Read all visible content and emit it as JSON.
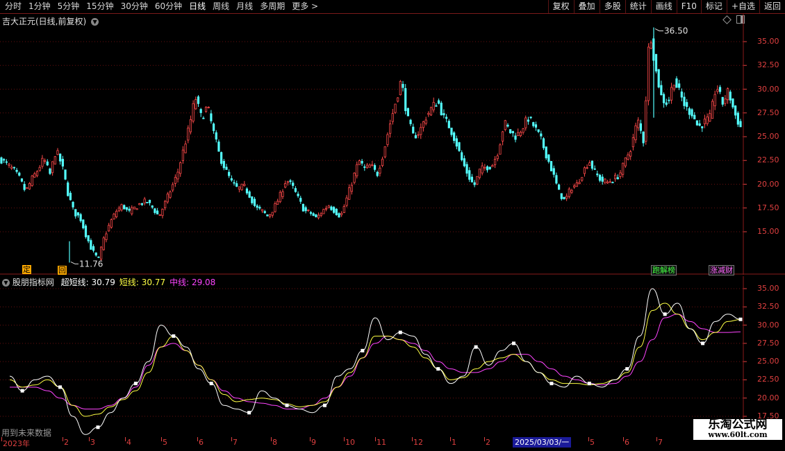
{
  "toolbar": {
    "periods": [
      "分时",
      "1分钟",
      "5分钟",
      "15分钟",
      "30分钟",
      "60分钟",
      "日线",
      "周线",
      "月线",
      "多周期",
      "更多 >"
    ],
    "active_period": "日线",
    "buttons": [
      "复权",
      "叠加",
      "多股",
      "统计",
      "画线",
      "F10",
      "标记",
      "+自选",
      "返回"
    ]
  },
  "main_panel": {
    "title": "吉大正元(日线,前复权)",
    "y_ticks": [
      "35.00",
      "32.50",
      "30.00",
      "27.50",
      "25.00",
      "22.50",
      "20.00",
      "17.50",
      "15.00"
    ],
    "high_label": "36.50",
    "low_label": "11.76",
    "tag_ding": "定",
    "tag_hui": "回",
    "tag_bejiebang": "跑解榜",
    "tag_zhangjiancai": "涨减财"
  },
  "indicator_panel": {
    "title": "股朋指标网",
    "lines": [
      {
        "label": "超短线:",
        "value": "30.79",
        "color": "#ffffff"
      },
      {
        "label": "短线:",
        "value": "30.77",
        "color": "#ffff44"
      },
      {
        "label": "中线:",
        "value": "29.08",
        "color": "#ff44ff"
      }
    ],
    "y_ticks": [
      "35.00",
      "32.50",
      "30.00",
      "27.50",
      "25.00",
      "22.50",
      "20.00",
      "17.50"
    ],
    "footer_note": "用到未来数据"
  },
  "date_axis": {
    "ticks": [
      "2023年",
      "2",
      "3",
      "4",
      "5",
      "6",
      "7",
      "8",
      "9",
      "10",
      "11",
      "12",
      "1",
      "2",
      "5",
      "6",
      "7"
    ],
    "highlight": "2025/03/03/一"
  },
  "watermark": {
    "line1": "乐淘公式网",
    "line2": "www.60lt.com"
  },
  "colors": {
    "up": "#ff4a4a",
    "down": "#54ffff",
    "axis": "#e04040",
    "grid": "#6a1010"
  },
  "chart_data": {
    "type": "line",
    "title": "吉大正元(日线,前复权)",
    "ylim": [
      12,
      37
    ],
    "high": 36.5,
    "low": 11.76,
    "price_path": [
      22.6,
      22.0,
      21.5,
      20.6,
      19.2,
      20.5,
      21.5,
      22.7,
      21.0,
      23.6,
      22.0,
      19.0,
      17.0,
      16.5,
      14.6,
      13.0,
      12.0,
      14.5,
      16.0,
      17.2,
      17.8,
      17.0,
      17.5,
      18.0,
      18.2,
      17.5,
      16.6,
      18.0,
      19.5,
      21.0,
      23.5,
      26.0,
      29.2,
      27.0,
      28.2,
      25.5,
      23.0,
      21.5,
      20.2,
      19.5,
      19.8,
      18.8,
      17.5,
      17.2,
      16.6,
      17.5,
      18.8,
      20.5,
      19.8,
      18.5,
      17.2,
      17.0,
      16.4,
      17.2,
      17.8,
      17.2,
      16.6,
      18.5,
      20.5,
      22.5,
      21.6,
      22.0,
      21.0,
      23.2,
      26.0,
      28.5,
      31.0,
      27.0,
      25.0,
      25.5,
      27.0,
      28.0,
      28.8,
      27.0,
      26.0,
      24.5,
      22.5,
      21.0,
      19.8,
      21.5,
      21.8,
      22.0,
      23.5,
      26.5,
      25.5,
      25.0,
      26.0,
      27.0,
      26.0,
      24.8,
      23.0,
      21.2,
      19.2,
      18.2,
      19.6,
      20.0,
      21.3,
      22.5,
      21.2,
      20.4,
      20.2,
      20.5,
      21.0,
      22.5,
      24.0,
      26.8,
      24.5,
      36.5,
      32.0,
      29.0,
      28.5,
      31.0,
      29.5,
      28.0,
      27.5,
      26.0,
      26.5,
      27.0,
      30.5,
      28.5,
      29.8,
      27.5,
      26.0
    ],
    "series": [
      {
        "name": "超短线",
        "values": [
          23.0,
          21.0,
          22.5,
          23.0,
          21.5,
          17.5,
          15.0,
          16.0,
          18.0,
          20.0,
          22.0,
          25.0,
          30.0,
          28.5,
          27.0,
          24.0,
          22.0,
          19.0,
          18.5,
          18.0,
          21.0,
          20.0,
          19.0,
          18.5,
          18.0,
          19.0,
          23.0,
          24.0,
          26.5,
          31.0,
          28.0,
          29.0,
          28.5,
          26.0,
          24.0,
          22.0,
          23.0,
          27.0,
          24.5,
          26.5,
          27.5,
          25.0,
          23.5,
          22.0,
          21.5,
          23.0,
          22.0,
          21.5,
          22.5,
          24.0,
          28.5,
          35.0,
          31.5,
          33.0,
          29.5,
          27.5,
          30.5,
          31.5,
          30.79
        ]
      },
      {
        "name": "短线",
        "values": [
          22.5,
          21.5,
          21.8,
          22.5,
          21.5,
          19.0,
          17.5,
          17.8,
          18.8,
          19.8,
          21.0,
          23.5,
          27.0,
          28.5,
          26.5,
          24.5,
          22.5,
          20.5,
          19.5,
          19.8,
          20.0,
          19.8,
          19.2,
          18.8,
          19.0,
          19.5,
          21.5,
          23.5,
          25.5,
          28.5,
          28.5,
          28.0,
          27.0,
          25.5,
          24.0,
          22.5,
          22.8,
          24.0,
          25.0,
          25.5,
          26.0,
          25.0,
          23.5,
          22.5,
          22.0,
          22.0,
          21.8,
          22.0,
          22.5,
          23.5,
          27.0,
          32.0,
          33.0,
          31.5,
          29.5,
          28.0,
          29.0,
          30.5,
          30.77
        ]
      },
      {
        "name": "中线",
        "values": [
          21.5,
          21.5,
          21.5,
          21.0,
          20.0,
          19.0,
          18.5,
          18.5,
          19.0,
          20.0,
          21.5,
          24.5,
          27.0,
          27.5,
          26.5,
          24.5,
          22.5,
          21.0,
          20.0,
          19.5,
          19.3,
          19.0,
          18.5,
          18.5,
          19.0,
          20.0,
          21.5,
          23.0,
          25.5,
          27.5,
          28.5,
          28.0,
          27.5,
          26.5,
          25.0,
          24.0,
          23.5,
          23.5,
          24.0,
          25.0,
          26.0,
          26.0,
          25.0,
          24.0,
          23.0,
          22.5,
          22.0,
          21.8,
          22.0,
          23.0,
          25.0,
          28.0,
          31.0,
          31.5,
          30.5,
          29.5,
          29.0,
          29.0,
          29.08
        ]
      }
    ]
  }
}
